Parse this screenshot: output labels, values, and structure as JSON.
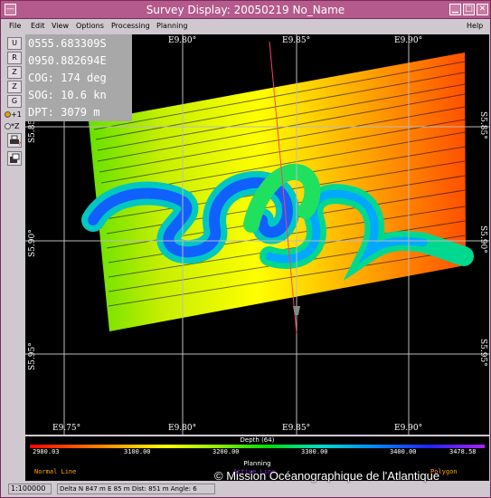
{
  "window": {
    "title": "Survey Display: 20050219 No_Name",
    "sysmenu_glyph": "—",
    "min_glyph": "▁",
    "max_glyph": "□",
    "close_glyph": "✕"
  },
  "menu": {
    "file": "File",
    "edit": "Edit",
    "view": "View",
    "options": "Options",
    "processing": "Processing",
    "planning": "Planning",
    "help": "Help"
  },
  "toolbar": {
    "u": "U",
    "r": "R",
    "z1": "Z",
    "z2": "Z",
    "g": "G",
    "radio_plus1": "+1",
    "radio_z": "*Z"
  },
  "info": {
    "lat": "0555.683309S",
    "lon": "0950.882694E",
    "cog": "COG: 174 deg",
    "sog": "SOG: 10.6 kn",
    "dpt": "DPT: 3079 m"
  },
  "map": {
    "lon_labels": [
      "E9.80°",
      "E9.85°",
      "E9.90°"
    ],
    "lon_labels_bottom": [
      "E9.75°",
      "E9.80°",
      "E9.85°",
      "E9.90°"
    ],
    "lat_labels": [
      "S5.85°",
      "S5.90°",
      "S5.95°"
    ],
    "lat_labels_right": [
      "S5.85°",
      "S5.90°",
      "S5.95°"
    ]
  },
  "legend": {
    "title": "Depth (64)",
    "ticks": [
      "2980.03",
      "3100.00",
      "3200.00",
      "3300.00",
      "3400.00",
      "3478.58"
    ],
    "planning_title": "Planning",
    "normal_line": "Normal Line",
    "active_line": "Active Line",
    "polygon": "Polygon",
    "normal_color": "#ffa500",
    "active_color": "#8a2be2",
    "polygon_color": "#ffa500"
  },
  "status": {
    "scale": "1:100000",
    "delta": "Delta N 847 m E 85 m Dist: 851 m Angle: 6"
  },
  "watermark": "© Mission Océanographique de l'Atlantique"
}
